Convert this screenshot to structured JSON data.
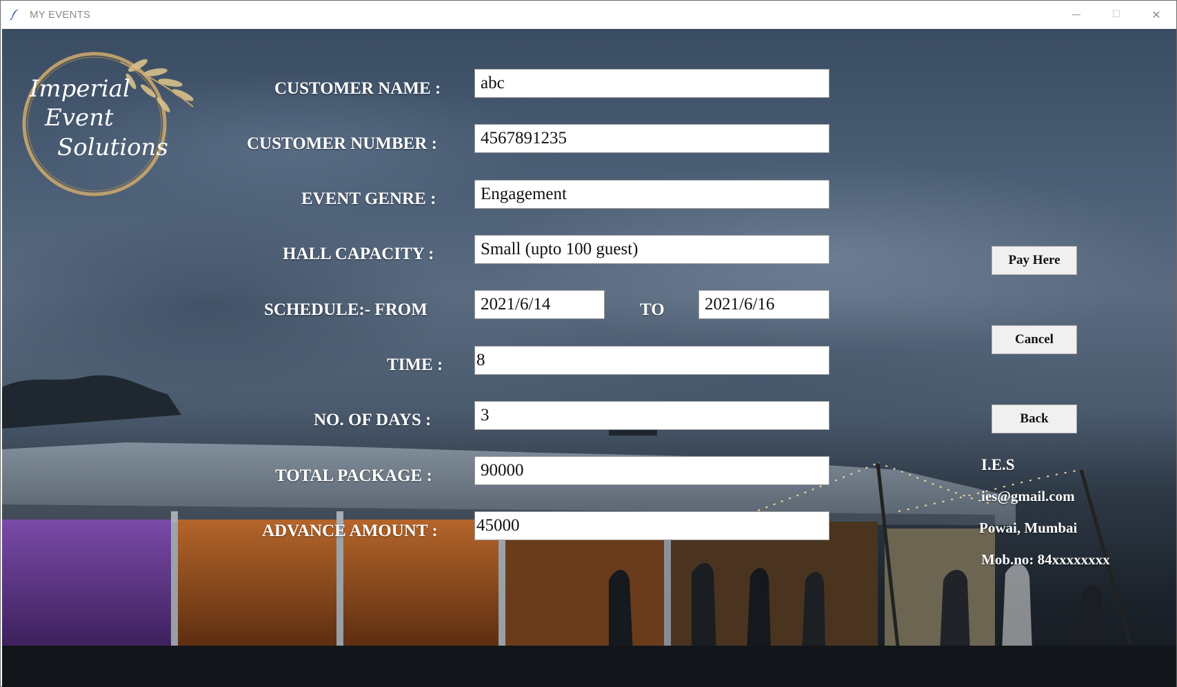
{
  "window": {
    "title": "MY EVENTS",
    "controls": {
      "minimize": "—",
      "maximize": "☐",
      "close": "✕"
    }
  },
  "logo": {
    "line1": "Imperial",
    "line2": "Event",
    "line3": "Solutions"
  },
  "form": {
    "customer_name": {
      "label": "CUSTOMER NAME :",
      "value": "abc"
    },
    "customer_number": {
      "label": "CUSTOMER NUMBER :",
      "value": "4567891235"
    },
    "event_genre": {
      "label": "EVENT GENRE :",
      "value": "Engagement"
    },
    "hall_capacity": {
      "label": "HALL CAPACITY :",
      "value": "Small (upto 100 guest)"
    },
    "schedule": {
      "label": "SCHEDULE:-  FROM",
      "from": "2021/6/14",
      "to_label": "TO",
      "to": "2021/6/16"
    },
    "time": {
      "label": "TIME :",
      "value": "8"
    },
    "days": {
      "label": "NO. OF DAYS :",
      "value": "3"
    },
    "total_package": {
      "label": "TOTAL PACKAGE :",
      "value": "90000"
    },
    "advance_amount": {
      "label": "ADVANCE AMOUNT :",
      "value": "45000"
    }
  },
  "buttons": {
    "pay": "Pay Here",
    "cancel": "Cancel",
    "back": "Back"
  },
  "info": {
    "name": "I.E.S",
    "email": "ies@gmail.com",
    "address": "Powai, Mumbai",
    "mobile": "Mob.no: 84xxxxxxxx"
  },
  "colors": {
    "label": "#ffffff",
    "input_bg": "#ffffff",
    "button_bg": "#f0f0f0",
    "gold": "#c9a66b"
  }
}
